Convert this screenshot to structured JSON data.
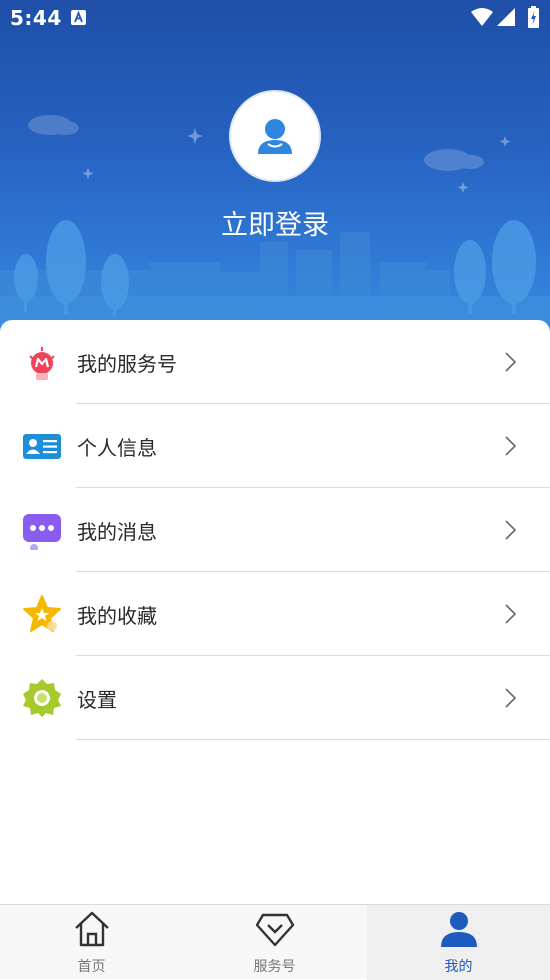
{
  "status_bar": {
    "time": "5:44",
    "icons": [
      "notification-a-icon",
      "wifi-icon",
      "signal-icon",
      "battery-charging-icon"
    ]
  },
  "profile": {
    "avatar_icon": "user-avatar-icon",
    "login_label": "立即登录"
  },
  "menu": {
    "items": [
      {
        "label": "我的服务号",
        "icon": "service-bulb-icon",
        "color": "#f0435a"
      },
      {
        "label": "个人信息",
        "icon": "id-card-icon",
        "color": "#1f8ed8"
      },
      {
        "label": "我的消息",
        "icon": "message-bubble-icon",
        "color": "#8a5cf0"
      },
      {
        "label": "我的收藏",
        "icon": "star-icon",
        "color": "#f5b800"
      },
      {
        "label": "设置",
        "icon": "gear-icon",
        "color": "#a6c92b"
      }
    ]
  },
  "bottom_nav": {
    "items": [
      {
        "label": "首页",
        "icon": "home-icon",
        "active": false
      },
      {
        "label": "服务号",
        "icon": "service-diamond-icon",
        "active": false
      },
      {
        "label": "我的",
        "icon": "person-icon",
        "active": true
      }
    ],
    "active_color": "#1d5bbf"
  },
  "colors": {
    "header_gradient_top": "#1f4fa8",
    "header_gradient_bottom": "#3a8be0"
  }
}
